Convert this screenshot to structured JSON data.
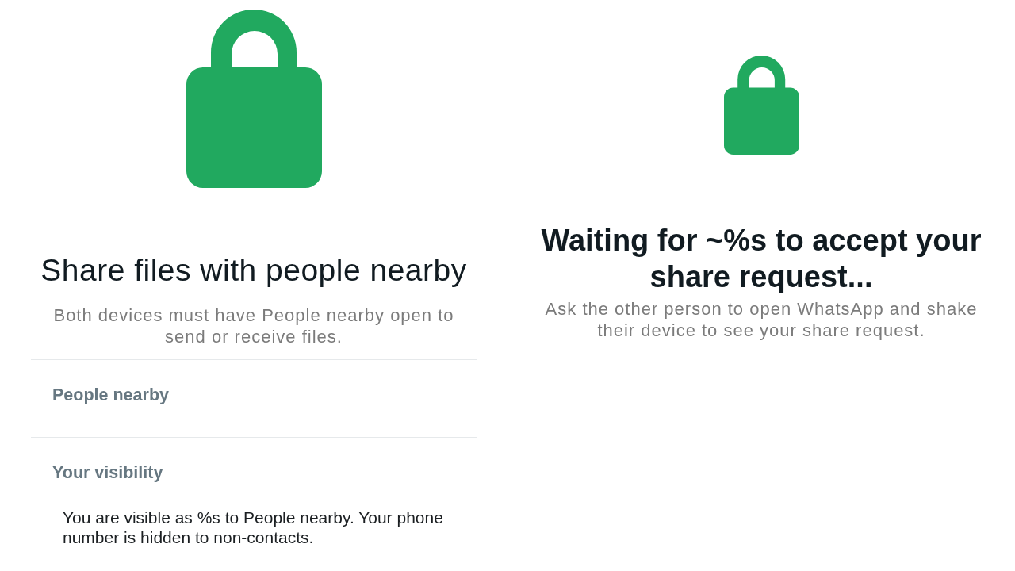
{
  "share_screen": {
    "title": "Share files with people nearby",
    "subtitle": "Both devices must have People nearby open to send or receive files.",
    "sections": [
      {
        "header": "People nearby"
      },
      {
        "header": "Your visibility",
        "body": "You are visible as %s to People nearby. Your phone number is hidden to non-contacts."
      }
    ]
  },
  "waiting_screen": {
    "title": "Waiting for ~%s to accept your share request...",
    "subtitle": "Ask the other person to open WhatsApp and shake their device to see your share request."
  }
}
